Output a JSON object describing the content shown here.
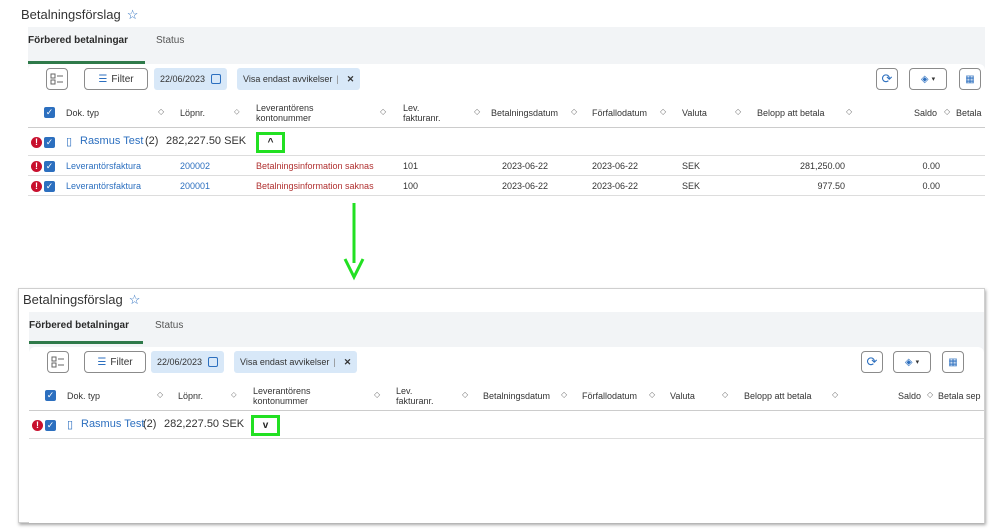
{
  "page_title": "Betalningsförslag",
  "tabs": [
    {
      "label": "Förbered betalningar",
      "active": true
    },
    {
      "label": "Status",
      "active": false
    }
  ],
  "toolbar": {
    "filter_label": "Filter",
    "date_chip": "22/06/2023",
    "deviation_chip": "Visa endast avvikelser",
    "deviation_sep": "|",
    "close_glyph": "✕"
  },
  "columns": [
    {
      "label": "Dok. typ"
    },
    {
      "label": "Löpnr."
    },
    {
      "label": "Leverantörens\nkontonummer"
    },
    {
      "label": "Lev.\nfakturanr."
    },
    {
      "label": "Betalningsdatum"
    },
    {
      "label": "Förfallodatum"
    },
    {
      "label": "Valuta"
    },
    {
      "label": "Belopp att betala"
    },
    {
      "label": "Saldo"
    },
    {
      "label_top": "Betala",
      "label_bottom": "Betala sep"
    }
  ],
  "group": {
    "name": "Rasmus Test",
    "count": "(2)",
    "amount": "282,227.50 SEK",
    "expanded_icon": "^",
    "collapsed_icon": "v"
  },
  "rows": [
    {
      "doc_type": "Leverantörsfaktura",
      "lopnr": "200002",
      "konto": "Betalningsinformation saknas",
      "faktnr": "101",
      "betdatum": "2023-06-22",
      "forfdatum": "2023-06-22",
      "valuta": "SEK",
      "belopp": "281,250.00",
      "saldo": "0.00"
    },
    {
      "doc_type": "Leverantörsfaktura",
      "lopnr": "200001",
      "konto": "Betalningsinformation saknas",
      "faktnr": "100",
      "betdatum": "2023-06-22",
      "forfdatum": "2023-06-22",
      "valuta": "SEK",
      "belopp": "977.50",
      "saldo": "0.00"
    }
  ],
  "colors": {
    "accent": "#2c6fbf",
    "tab_underline": "#2f7a4a",
    "highlight": "#22e022",
    "error": "#c8102e"
  },
  "icons": [
    "star-icon",
    "checklist-icon",
    "filter-sliders-icon",
    "calendar-icon",
    "refresh-icon",
    "layers-icon",
    "export-icon",
    "warning-icon",
    "checkbox-icon",
    "building-icon",
    "chevron-up-icon",
    "chevron-down-icon",
    "arrow-down-icon"
  ]
}
